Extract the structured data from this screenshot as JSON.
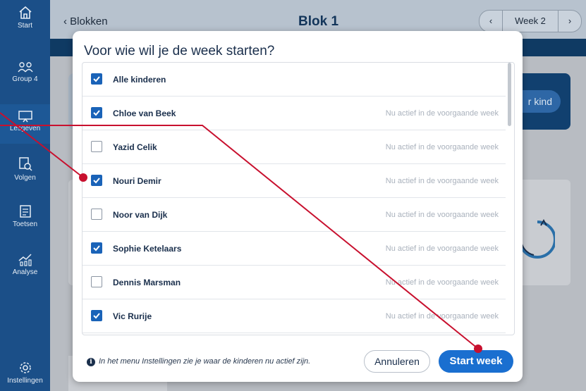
{
  "sidebar": {
    "items": [
      {
        "label": "Start",
        "icon": "home-icon"
      },
      {
        "label": "Group 4",
        "icon": "group-icon"
      },
      {
        "label": "Lesgeven",
        "icon": "teach-icon"
      },
      {
        "label": "Volgen",
        "icon": "follow-icon"
      },
      {
        "label": "Toetsen",
        "icon": "test-icon"
      },
      {
        "label": "Analyse",
        "icon": "analysis-icon"
      },
      {
        "label": "Instellingen",
        "icon": "gear-icon"
      }
    ]
  },
  "header": {
    "back_label": "Blokken",
    "title": "Blok 1",
    "week_label": "Week 2"
  },
  "background": {
    "pill_label": "r kind"
  },
  "modal": {
    "title": "Voor wie wil je de week starten?",
    "all_label": "Alle kinderen",
    "rows": [
      {
        "name": "Chloe van Beek",
        "checked": true,
        "status": "Nu actief in de voorgaande week"
      },
      {
        "name": "Yazid Celik",
        "checked": false,
        "status": "Nu actief in de voorgaande week"
      },
      {
        "name": "Nouri Demir",
        "checked": true,
        "status": "Nu actief in de voorgaande week"
      },
      {
        "name": "Noor van Dijk",
        "checked": false,
        "status": "Nu actief in de voorgaande week"
      },
      {
        "name": "Sophie Ketelaars",
        "checked": true,
        "status": "Nu actief in de voorgaande week"
      },
      {
        "name": "Dennis Marsman",
        "checked": false,
        "status": "Nu actief in de voorgaande week"
      },
      {
        "name": "Vic Rurije",
        "checked": true,
        "status": "Nu actief in de voorgaande week"
      }
    ],
    "info_text": "In het menu Instellingen zie je waar de kinderen nu actief zijn.",
    "cancel_label": "Annuleren",
    "start_label": "Start week"
  },
  "colors": {
    "sidebar": "#1b4f88",
    "accent": "#1a6fd0",
    "annotation": "#c8102e"
  }
}
